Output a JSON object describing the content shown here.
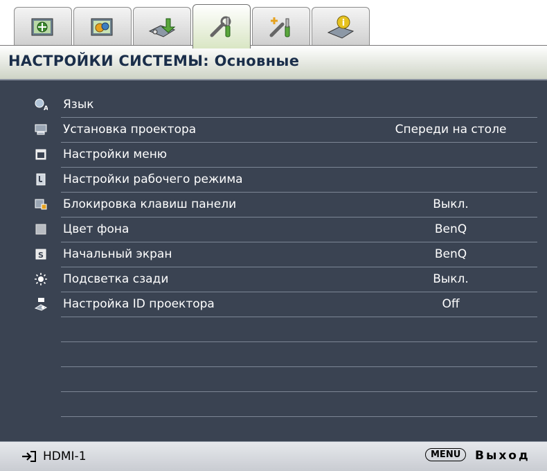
{
  "tabs": [
    {
      "icon": "picture-settings-icon",
      "active": false
    },
    {
      "icon": "advanced-picture-icon",
      "active": false
    },
    {
      "icon": "display-icon",
      "active": false
    },
    {
      "icon": "system-basic-icon",
      "active": true
    },
    {
      "icon": "system-advanced-icon",
      "active": false
    },
    {
      "icon": "information-icon",
      "active": false
    }
  ],
  "title": "НАСТРОЙКИ СИСТЕМЫ: Основные",
  "menu": {
    "items": [
      {
        "icon": "language-icon",
        "label": "Язык",
        "value": ""
      },
      {
        "icon": "projector-position-icon",
        "label": "Установка проектора",
        "value": "Спереди на столе"
      },
      {
        "icon": "menu-settings-icon",
        "label": "Настройки меню",
        "value": ""
      },
      {
        "icon": "operation-settings-icon",
        "label": "Настройки рабочего режима",
        "value": ""
      },
      {
        "icon": "panel-key-lock-icon",
        "label": "Блокировка клавиш панели",
        "value": "Выкл."
      },
      {
        "icon": "background-color-icon",
        "label": "Цвет фона",
        "value": "BenQ"
      },
      {
        "icon": "splash-screen-icon",
        "label": "Начальный экран",
        "value": "BenQ"
      },
      {
        "icon": "backlight-icon",
        "label": "Подсветка сзади",
        "value": "Выкл."
      },
      {
        "icon": "projector-id-icon",
        "label": "Настройка ID проектора",
        "value": "Off"
      }
    ]
  },
  "status": {
    "source": "HDMI-1",
    "menu_key": "MENU",
    "exit_label": "Выход"
  },
  "colors": {
    "panel_bg": "#3a4352",
    "title_text": "#1a2e4a",
    "row_divider": "#7d8796"
  }
}
